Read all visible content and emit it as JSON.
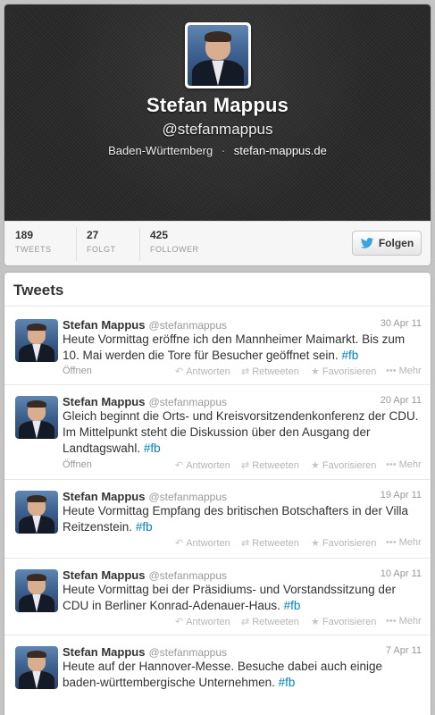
{
  "profile": {
    "name": "Stefan Mappus",
    "handle": "@stefanmappus",
    "location": "Baden-Württemberg",
    "separator": "·",
    "website": "stefan-mappus.de"
  },
  "stats": [
    {
      "value": "189",
      "label": "TWEETS"
    },
    {
      "value": "27",
      "label": "FOLGT"
    },
    {
      "value": "425",
      "label": "FOLLOWER"
    }
  ],
  "follow_button": {
    "label": "Folgen",
    "icon": "bird-icon"
  },
  "tweets_section": {
    "heading": "Tweets"
  },
  "action_labels": {
    "open": "Öffnen",
    "reply": "Antworten",
    "retweet": "Retweeten",
    "favorite": "Favorisieren",
    "more": "Mehr"
  },
  "tweets": [
    {
      "name": "Stefan Mappus",
      "handle": "@stefanmappus",
      "time": "30 Apr 11",
      "text": "Heute Vormittag eröffne ich den Mannheimer Maimarkt. Bis zum 10. Mai werden die Tore für Besucher geöffnet sein.",
      "hashtag": "#fb"
    },
    {
      "name": "Stefan Mappus",
      "handle": "@stefanmappus",
      "time": "20 Apr 11",
      "text": "Gleich beginnt die Orts- und Kreisvorsitzendenkonferenz der CDU. Im Mittelpunkt steht die Diskussion über den Ausgang der Landtagswahl.",
      "hashtag": "#fb"
    },
    {
      "name": "Stefan Mappus",
      "handle": "@stefanmappus",
      "time": "19 Apr 11",
      "text": "Heute Vormittag Empfang des britischen Botschafters in der Villa Reitzenstein.",
      "hashtag": "#fb"
    },
    {
      "name": "Stefan Mappus",
      "handle": "@stefanmappus",
      "time": "10 Apr 11",
      "text": "Heute Vormittag bei der Präsidiums- und Vorstandssitzung der CDU in Berliner Konrad-Adenauer-Haus.",
      "hashtag": "#fb"
    },
    {
      "name": "Stefan Mappus",
      "handle": "@stefanmappus",
      "time": "7 Apr 11",
      "text": "Heute auf der Hannover-Messe. Besuche dabei auch einige baden-württembergische Unternehmen.",
      "hashtag": "#fb"
    }
  ],
  "colors": {
    "link": "#0084b4",
    "header_bg": "#2a2a2a"
  }
}
